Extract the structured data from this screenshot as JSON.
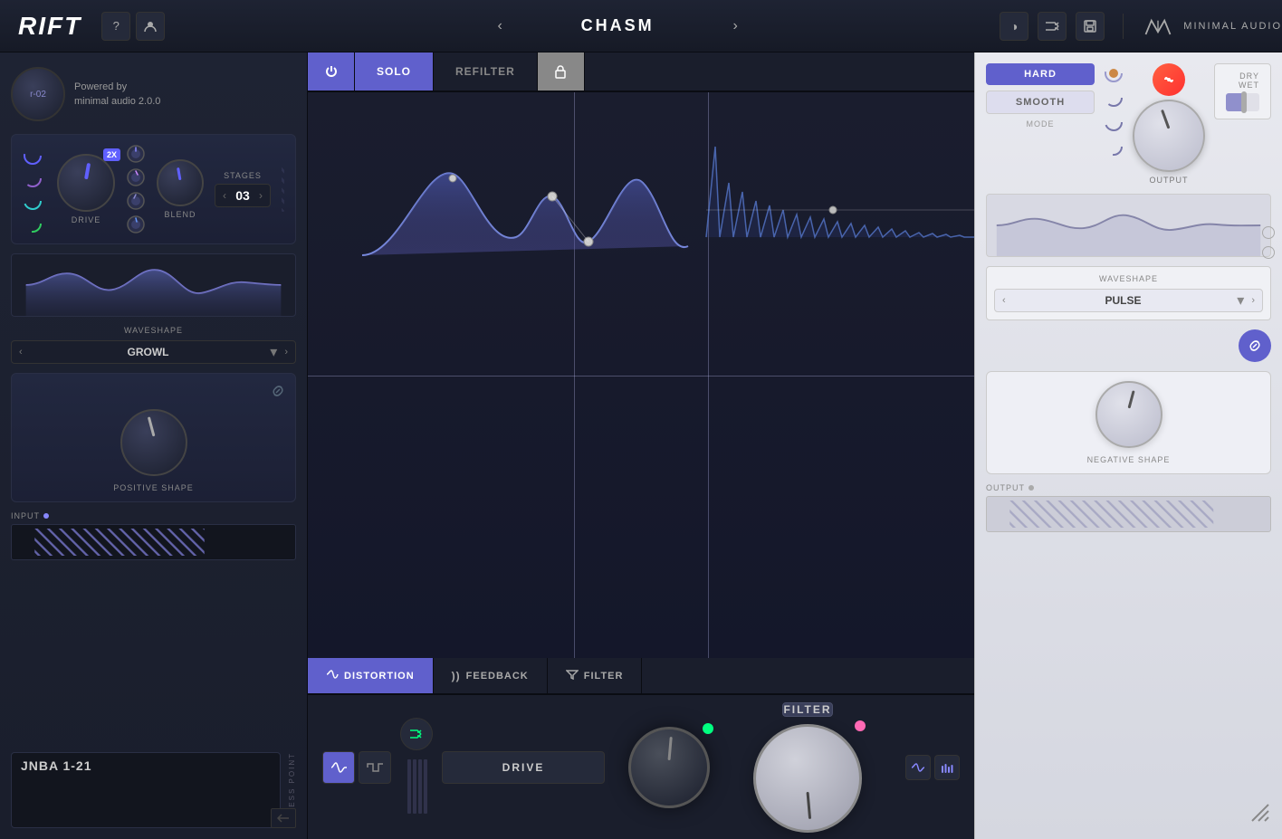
{
  "app": {
    "title": "RIFT",
    "subtitle": "minimal audio 2.0.0",
    "powered_by": "Powered by"
  },
  "top_bar": {
    "logo": "RIFT",
    "help_label": "?",
    "user_label": "👤",
    "prev_label": "‹",
    "next_label": "›",
    "preset_name": "CHASM",
    "half_moon_label": "◑",
    "shuffle_label": "⇄",
    "save_label": "💾",
    "brand": "MINIMAL AUDIO"
  },
  "drive_section": {
    "drive_label": "DRIVE",
    "blend_label": "BLEND",
    "stages_label": "STAGES",
    "stages_value": "03",
    "badge": "2X"
  },
  "mode": {
    "hard_label": "HARD",
    "smooth_label": "SMOOTH",
    "mode_label": "MODE"
  },
  "output": {
    "label": "OUTPUT",
    "drywet_label": "DRY WET"
  },
  "tabs": {
    "power_icon": "⏻",
    "solo_label": "SOLO",
    "refilter_label": "REFILTER",
    "lock_icon": "🔒"
  },
  "bottom_tabs": {
    "distortion_label": "DISTORTION",
    "feedback_label": "FEEDBACK",
    "filter_label": "FILTER"
  },
  "left_panel": {
    "waveshape_label": "WAVESHAPE",
    "waveshape_value": "GROWL",
    "positive_shape_label": "POSITIVE SHAPE",
    "input_label": "INPUT",
    "preset_id": "r-02"
  },
  "right_panel": {
    "waveshape_label": "WAVESHAPE",
    "waveshape_value": "PULSE",
    "negative_shape_label": "NEGATIVE SHAPE",
    "output_label": "OUTPUT"
  },
  "bottom_center": {
    "drive_button_label": "DRIVE",
    "filter_button_label": "FILTER"
  },
  "patch": {
    "id": "JNBA 1-21",
    "access_point_label": "ACCESS POINT"
  },
  "icons": {
    "link": "🔗",
    "shuffle": "⇄",
    "wave_sine": "∿",
    "wave_square": "⊓",
    "power": "⏻",
    "lock": "🔒",
    "save": "💾",
    "half_circle": "◑",
    "bars": "≡"
  }
}
